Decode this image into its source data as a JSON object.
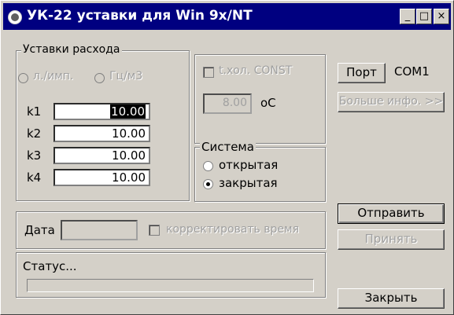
{
  "window": {
    "title": "УК-22 уставки для Win 9x/NT",
    "controls": {
      "minimize": "_",
      "maximize": "□",
      "close": "×"
    }
  },
  "rate_group": {
    "title": "Уставки расхода",
    "radio_1": "л./имп.",
    "radio_2": "Гц/м3",
    "rows": [
      {
        "label": "k1",
        "value": "10.00"
      },
      {
        "label": "k2",
        "value": "10.00"
      },
      {
        "label": "k3",
        "value": "10.00"
      },
      {
        "label": "k4",
        "value": "10.00"
      }
    ]
  },
  "temp": {
    "checkbox_label": "t.хол. CONST",
    "value": "8.00",
    "unit": "oC"
  },
  "system_group": {
    "title": "Система",
    "option_open": "открытая",
    "option_closed": "закрытая",
    "selected": "закрытая"
  },
  "port": {
    "button_label": "Порт",
    "value": "COM1",
    "more_info_label": "Больше инфо. >>"
  },
  "date": {
    "label": "Дата",
    "value": "",
    "correct_time_label": "корректировать время"
  },
  "status": {
    "title": "Статус...",
    "progress": 0
  },
  "buttons": {
    "send": "Отправить",
    "receive": "Принять",
    "close": "Закрыть"
  }
}
